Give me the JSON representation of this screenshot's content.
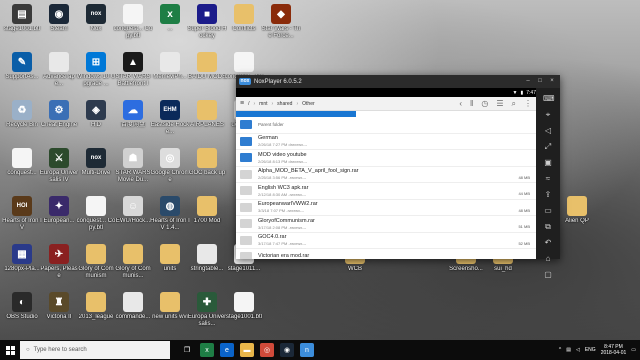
{
  "desktop": {
    "icons": [
      {
        "label": "stage1001.btl",
        "color": "#3a3a3a",
        "glyph": "▤",
        "col": 0,
        "row": 0
      },
      {
        "label": "Steam",
        "color": "#1b2838",
        "glyph": "◉",
        "col": 1,
        "row": 0
      },
      {
        "label": "Nox",
        "color": "#1e2a35",
        "glyph": "nox",
        "col": 2,
        "row": 0
      },
      {
        "label": "conquest... Copy.btl",
        "color": "#f5f5f5",
        "glyph": "",
        "col": 3,
        "row": 0
      },
      {
        "label": "...",
        "color": "#1e7e45",
        "glyph": "x",
        "col": 4,
        "row": 0
      },
      {
        "label": "Super Blood Hockey",
        "color": "#1c1c8a",
        "glyph": "■",
        "col": 5,
        "row": 0
      },
      {
        "label": "Conflicts",
        "color": "#e8c06a",
        "glyph": "",
        "col": 6,
        "row": 0
      },
      {
        "label": "Star Wars - The Force...",
        "color": "#8a2b0a",
        "glyph": "◆",
        "col": 7,
        "row": 0
      },
      {
        "label": "SupportAs...",
        "color": "#0a5ea8",
        "glyph": "✎",
        "col": 0,
        "row": 1
      },
      {
        "label": "Advance ape...",
        "color": "#e8e8e8",
        "glyph": "",
        "col": 1,
        "row": 1
      },
      {
        "label": "Windows 10 Upgrade ...",
        "color": "#0078d7",
        "glyph": "⊞",
        "col": 2,
        "row": 1
      },
      {
        "label": "STAR WARS Battlefront I",
        "color": "#1a1a1a",
        "glyph": "▲",
        "col": 3,
        "row": 1
      },
      {
        "label": "MemeviPh...",
        "color": "#e8e8e8",
        "glyph": "",
        "col": 4,
        "row": 1
      },
      {
        "label": "BAIDU MODS",
        "color": "#e8c06a",
        "glyph": "",
        "col": 5,
        "row": 1
      },
      {
        "label": "conquest... Copy.btl",
        "color": "#f5f5f5",
        "glyph": "",
        "col": 6,
        "row": 1
      },
      {
        "label": "Recycle Bin",
        "color": "#9ab0c8",
        "glyph": "♻",
        "col": 0,
        "row": 2
      },
      {
        "label": "Cheat Engine",
        "color": "#3b6fb5",
        "glyph": "⚙",
        "col": 1,
        "row": 2
      },
      {
        "label": "HiD",
        "color": "#2e3b4e",
        "glyph": "◈",
        "col": 2,
        "row": 2
      },
      {
        "label": "百度网盘",
        "color": "#2d6de0",
        "glyph": "☁",
        "col": 3,
        "row": 2
      },
      {
        "label": "Eastside Hocke...",
        "color": "#0b2a5a",
        "glyph": "EHM",
        "col": 4,
        "row": 2
      },
      {
        "label": "AIRPLANES",
        "color": "#e8c06a",
        "glyph": "",
        "col": 5,
        "row": 2
      },
      {
        "label": "def_army",
        "color": "#e8e8e8",
        "glyph": "",
        "col": 6,
        "row": 2
      },
      {
        "label": "conquest...",
        "color": "#f5f5f5",
        "glyph": "",
        "col": 0,
        "row": 3
      },
      {
        "label": "Europa Universalis IV",
        "color": "#2c4a2c",
        "glyph": "⚔",
        "col": 1,
        "row": 3
      },
      {
        "label": "Multi-Drive",
        "color": "#1e2a35",
        "glyph": "nox",
        "col": 2,
        "row": 3
      },
      {
        "label": "STAR WARS Movie Du...",
        "color": "#d0d0d0",
        "glyph": "☗",
        "col": 3,
        "row": 3
      },
      {
        "label": "Google Chrome",
        "color": "#dddddd",
        "glyph": "◎",
        "col": 4,
        "row": 3
      },
      {
        "label": "GOC back up",
        "color": "#e8c06a",
        "glyph": "",
        "col": 5,
        "row": 3
      },
      {
        "label": "Hearts of Iron IV",
        "color": "#5a3a1a",
        "glyph": "HOI",
        "col": 0,
        "row": 4
      },
      {
        "label": "European...",
        "color": "#3a2a6a",
        "glyph": "✦",
        "col": 1,
        "row": 4
      },
      {
        "label": "conquest... Copy.btl",
        "color": "#f5f5f5",
        "glyph": "",
        "col": 2,
        "row": 4
      },
      {
        "label": "EWU/Hock...",
        "color": "#d8d8d8",
        "glyph": "☺",
        "col": 3,
        "row": 4
      },
      {
        "label": "Hearts of Iron IV 1.4...",
        "color": "#2a4a6a",
        "glyph": "◍",
        "col": 4,
        "row": 4
      },
      {
        "label": "1700 Mod",
        "color": "#e8c06a",
        "glyph": "",
        "col": 5,
        "row": 4
      },
      {
        "label": "1280px-Pla...",
        "color": "#2a3a8a",
        "glyph": "▦",
        "col": 0,
        "row": 5
      },
      {
        "label": "Papers, Please",
        "color": "#8a2020",
        "glyph": "✈",
        "col": 1,
        "row": 5
      },
      {
        "label": "Glory of Communism",
        "color": "#e8c06a",
        "glyph": "",
        "col": 2,
        "row": 5
      },
      {
        "label": "Glory of Communis...",
        "color": "#e8c06a",
        "glyph": "",
        "col": 3,
        "row": 5
      },
      {
        "label": "units",
        "color": "#e8c06a",
        "glyph": "",
        "col": 4,
        "row": 5
      },
      {
        "label": "stringtable...",
        "color": "#e8e8e8",
        "glyph": "",
        "col": 5,
        "row": 5
      },
      {
        "label": "stage1011...",
        "color": "#f5f5f5",
        "glyph": "",
        "col": 6,
        "row": 5
      },
      {
        "label": "OBS Studio",
        "color": "#2a2a2a",
        "glyph": "◐",
        "col": 0,
        "row": 6
      },
      {
        "label": "Victoria II",
        "color": "#5a4a2a",
        "glyph": "♜",
        "col": 1,
        "row": 6
      },
      {
        "label": "2013_league",
        "color": "#e8c06a",
        "glyph": "",
        "col": 2,
        "row": 6
      },
      {
        "label": "commande...",
        "color": "#e8e8e8",
        "glyph": "",
        "col": 3,
        "row": 6
      },
      {
        "label": "new units wvi",
        "color": "#e8c06a",
        "glyph": "",
        "col": 4,
        "row": 6
      },
      {
        "label": "Europa Universalis...",
        "color": "#2a5a3a",
        "glyph": "✚",
        "col": 5,
        "row": 6
      },
      {
        "label": "stage1001.btl",
        "color": "#f5f5f5",
        "glyph": "",
        "col": 6,
        "row": 6
      },
      {
        "label": "Alien QP",
        "color": "#e8c06a",
        "glyph": "",
        "col": 15,
        "row": 4
      },
      {
        "label": "WCB",
        "color": "#e8c06a",
        "glyph": "",
        "col": 9,
        "row": 5
      },
      {
        "label": "Screensho...",
        "color": "#e8c06a",
        "glyph": "",
        "col": 12,
        "row": 5
      },
      {
        "label": "sui_hd",
        "color": "#e8c06a",
        "glyph": "",
        "col": 13,
        "row": 5
      }
    ]
  },
  "nox": {
    "title": "NoxPlayer 6.0.5.2",
    "status_time": "7:47",
    "window_buttons": [
      "–",
      "□",
      "×"
    ],
    "breadcrumb": [
      "/",
      "mnt",
      "shared",
      "Other"
    ],
    "toolbar_icons": [
      "pause-icon",
      "history-icon",
      "filter-icon",
      "search-icon",
      "more-icon"
    ],
    "files": [
      {
        "name": "Parent folder",
        "meta": "",
        "size": "",
        "type": "parent"
      },
      {
        "name": "German",
        "meta": "2/26/18 7:27 PM   drwxrwx---",
        "size": "",
        "type": "folder"
      },
      {
        "name": "MOD video youtube",
        "meta": "2/26/18 8:13 PM   drwxrwx---",
        "size": "",
        "type": "folder"
      },
      {
        "name": "Alpha_MOD_BETA_V_april_fool_sign.rar",
        "meta": "2/25/18 3:56 PM   -rwxrwx---",
        "size": "48 MB",
        "type": "file"
      },
      {
        "name": "English WC3 apk.rar",
        "meta": "2/12/18 8:30 AM   -rwxrwx---",
        "size": "44 MB",
        "type": "file"
      },
      {
        "name": "EuropeanwarIVWW2.rar",
        "meta": "3/3/18 7:07 PM   -rwxrwx---",
        "size": "48 MB",
        "type": "file"
      },
      {
        "name": "GloryofCommunism.rar",
        "meta": "3/17/18 2:08 PM   -rwxrwx---",
        "size": "51 MB",
        "type": "file"
      },
      {
        "name": "GOC4.0.rar",
        "meta": "3/17/18 7:47 PM   -rwxrwx---",
        "size": "52 MB",
        "type": "file"
      },
      {
        "name": "Victorian era mod.rar",
        "meta": "",
        "size": "",
        "type": "file"
      }
    ],
    "sidebar_icons": [
      "keyboard-icon",
      "location-icon",
      "volume-icon",
      "fullscreen-icon",
      "screenshot-icon",
      "shake-icon",
      "apk-icon",
      "folder-icon",
      "multi-icon",
      "back-icon",
      "home-icon",
      "recent-icon"
    ]
  },
  "taskbar": {
    "search_placeholder": "Type here to search",
    "apps": [
      {
        "name": "task-view",
        "color": "#0c0c0c",
        "glyph": "❐"
      },
      {
        "name": "excel",
        "color": "#1e7e45",
        "glyph": "x"
      },
      {
        "name": "edge",
        "color": "#0a63c9",
        "glyph": "e"
      },
      {
        "name": "file-explorer",
        "color": "#e8b64a",
        "glyph": "▬"
      },
      {
        "name": "chrome",
        "color": "#d04a3a",
        "glyph": "◎"
      },
      {
        "name": "steam",
        "color": "#1b2838",
        "glyph": "◉"
      },
      {
        "name": "nox",
        "color": "#3c8ddb",
        "glyph": "n"
      }
    ],
    "language": "ENG",
    "time": "8:47 PM",
    "date": "2018-04-01"
  }
}
